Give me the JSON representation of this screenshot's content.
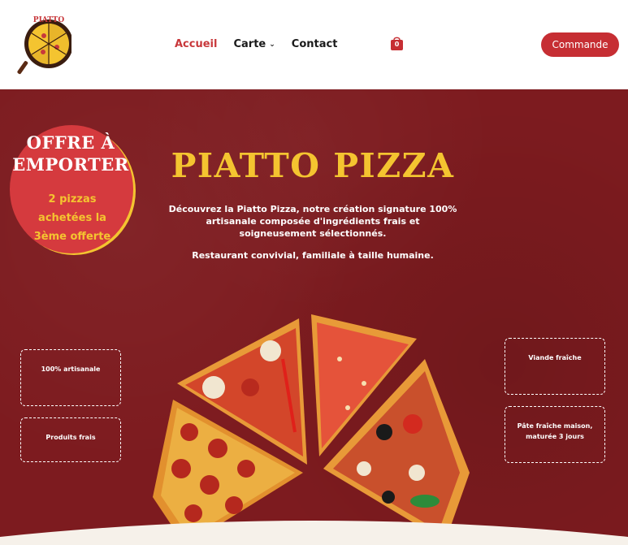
{
  "header": {
    "logo": {
      "text": "PIATTO",
      "icon": "pizza-logo-icon"
    },
    "nav": [
      {
        "label": "Accueil",
        "active": true
      },
      {
        "label": "Carte",
        "has_dropdown": true
      },
      {
        "label": "Contact"
      }
    ],
    "cart": {
      "count": "0",
      "icon": "shopping-bag-icon"
    },
    "order_button": "Commande"
  },
  "promo": {
    "title_line1": "OFFRE À",
    "title_line2": "EMPORTER",
    "sub_line1": "2 pizzas",
    "sub_line2": "achetées la",
    "sub_line3": "3ème offerte"
  },
  "hero": {
    "title": "PIATTO PIZZA",
    "desc_line1": "Découvrez la Piatto Pizza, notre création signature 100%",
    "desc_line2": "artisanale composée d'ingrédients frais et",
    "desc_line3": "soigneusement sélectionnés.",
    "desc2": "Restaurant convivial, familiale à taille humaine."
  },
  "features": {
    "f1": "100% artisanale",
    "f2": "Produits frais",
    "f3": "Viande fraîche",
    "f4_line1": "Pâte fraîche maison,",
    "f4_line2": "maturée 3 jours"
  },
  "colors": {
    "brand_red": "#c62e33",
    "hero_bg": "#7d1b1f",
    "accent_yellow": "#f4c430"
  }
}
